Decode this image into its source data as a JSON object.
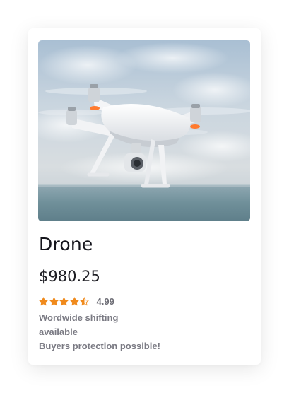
{
  "product": {
    "image_icon": "drone-photo",
    "title": "Drone",
    "price": "$980.25",
    "rating": {
      "value": 4.5,
      "max": 5,
      "label": "4.99",
      "star_color": "#f08a1c"
    },
    "shipping_line1": "Wordwide shifting",
    "shipping_line2": "available",
    "protection": "Buyers protection possible!"
  }
}
